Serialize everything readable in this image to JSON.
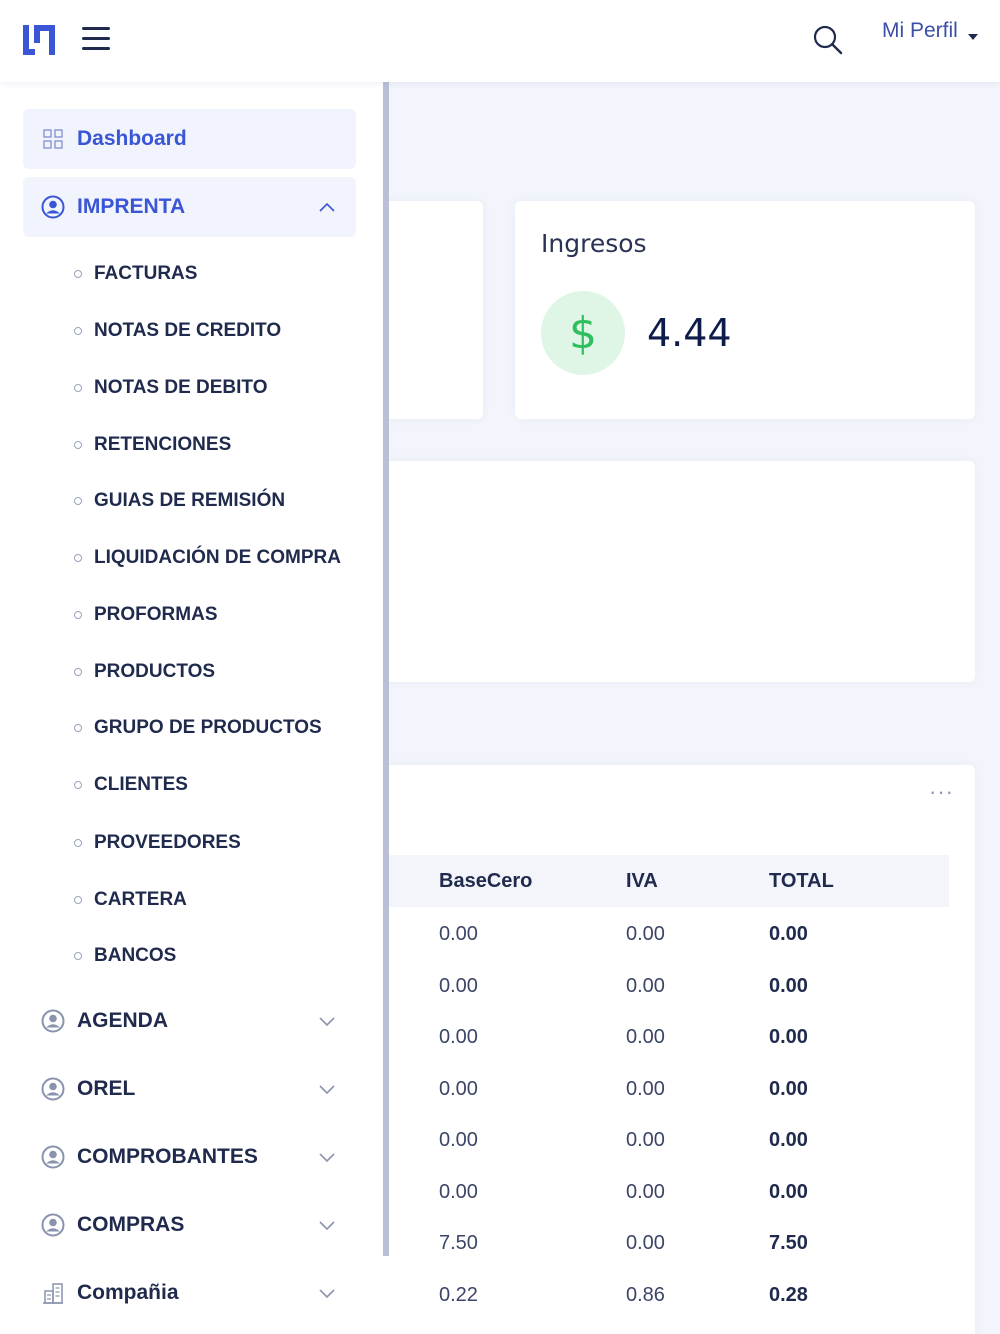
{
  "header": {
    "profile_label": "Mi Perfil"
  },
  "colors": {
    "accent": "#3a55d6",
    "success": "#2fbf5e",
    "text_dark": "#1f2a4d"
  },
  "sidebar": {
    "dashboard": "Dashboard",
    "imprenta": "IMPRENTA",
    "imprenta_items": [
      "FACTURAS",
      "NOTAS DE CREDITO",
      "NOTAS DE DEBITO",
      "RETENCIONES",
      "GUIAS DE REMISIÓN",
      "LIQUIDACIÓN DE COMPRA",
      "PROFORMAS",
      "PRODUCTOS",
      "GRUPO DE PRODUCTOS",
      "CLIENTES",
      "PROVEEDORES",
      "CARTERA",
      "BANCOS"
    ],
    "agenda": "AGENDA",
    "orel": "OREL",
    "comprobantes": "COMPROBANTES",
    "compras": "COMPRAS",
    "compania": "Compañia"
  },
  "ingresos": {
    "title": "Ingresos",
    "symbol": "$",
    "value": "4.44"
  },
  "table": {
    "more": "···",
    "headers": [
      "BaseCero",
      "IVA",
      "TOTAL"
    ],
    "rows": [
      [
        "0.00",
        "0.00",
        "0.00"
      ],
      [
        "0.00",
        "0.00",
        "0.00"
      ],
      [
        "0.00",
        "0.00",
        "0.00"
      ],
      [
        "0.00",
        "0.00",
        "0.00"
      ],
      [
        "0.00",
        "0.00",
        "0.00"
      ],
      [
        "0.00",
        "0.00",
        "0.00"
      ],
      [
        "7.50",
        "0.00",
        "7.50"
      ],
      [
        "0.22",
        "0.86",
        "0.28"
      ]
    ]
  }
}
